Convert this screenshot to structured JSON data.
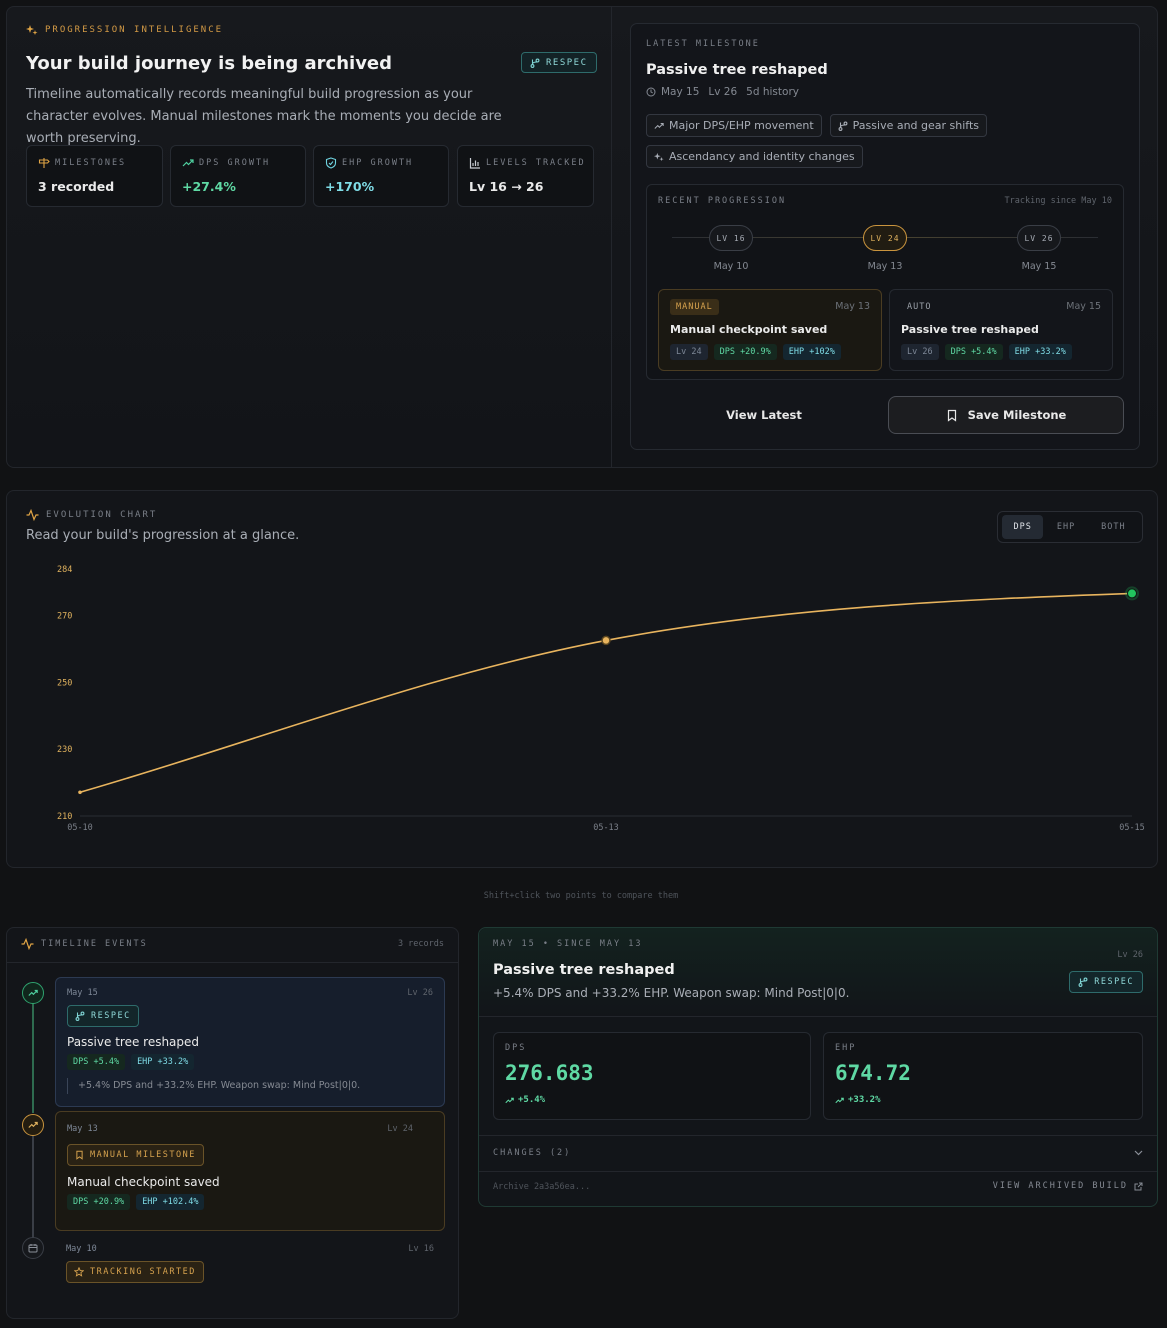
{
  "hero": {
    "eyebrow": "PROGRESSION INTELLIGENCE",
    "title": "Your build journey is being archived",
    "badge": "RESPEC",
    "description": "Timeline automatically records meaningful build progression as your character evolves. Manual milestones mark the moments you decide are worth preserving.",
    "stats": [
      {
        "label": "MILESTONES",
        "value": "3 recorded",
        "icon": "signpost-icon"
      },
      {
        "label": "DPS GROWTH",
        "value": "+27.4%",
        "icon": "trend-up-icon"
      },
      {
        "label": "EHP GROWTH",
        "value": "+170%",
        "icon": "shield-icon"
      },
      {
        "label": "LEVELS TRACKED",
        "value": "Lv 16 → 26",
        "icon": "bar-chart-icon"
      }
    ]
  },
  "latest": {
    "eyebrow": "LATEST MILESTONE",
    "title": "Passive tree reshaped",
    "date": "May 15",
    "level": "Lv 26",
    "history": "5d history",
    "tags": [
      "Major DPS/EHP movement",
      "Passive and gear shifts",
      "Ascendancy and identity changes"
    ],
    "recent": {
      "label": "RECENT PROGRESSION",
      "since": "Tracking since May 10",
      "nodes": [
        {
          "level": "LV 16",
          "date": "May 10"
        },
        {
          "level": "LV 24",
          "date": "May 13"
        },
        {
          "level": "LV 26",
          "date": "May 15"
        }
      ],
      "cards": [
        {
          "type": "MANUAL",
          "date": "May 13",
          "title": "Manual checkpoint saved",
          "lv": "Lv 24",
          "dps": "DPS +20.9%",
          "ehp": "EHP +102%"
        },
        {
          "type": "AUTO",
          "date": "May 15",
          "title": "Passive tree reshaped",
          "lv": "Lv 26",
          "dps": "DPS +5.4%",
          "ehp": "EHP +33.2%"
        }
      ]
    },
    "view_latest": "View Latest",
    "save_milestone": "Save Milestone"
  },
  "chart": {
    "eyebrow": "EVOLUTION CHART",
    "subtitle": "Read your build's progression at a glance.",
    "toggles": [
      "DPS",
      "EHP",
      "BOTH"
    ],
    "hint": "Shift+click two points to compare them"
  },
  "chart_data": {
    "type": "line",
    "x": [
      "05-10",
      "05-13",
      "05-15"
    ],
    "series": [
      {
        "values": [
          217.1,
          262.6,
          276.683
        ]
      }
    ],
    "ylim": [
      210,
      284
    ],
    "yticks": [
      210,
      230,
      250,
      270,
      284
    ],
    "grid": false,
    "colors": {
      "line": "#e8b45e",
      "end_point": "#22c55e"
    }
  },
  "timeline": {
    "title": "TIMELINE EVENTS",
    "count": "3 records",
    "events": [
      {
        "date": "May 15",
        "level": "Lv 26",
        "badge": "RESPEC",
        "title": "Passive tree reshaped",
        "dps": "DPS +5.4%",
        "ehp": "EHP +33.2%",
        "note": "+5.4% DPS and +33.2% EHP. Weapon swap: Mind Post|0|0."
      },
      {
        "date": "May 13",
        "level": "Lv 24",
        "badge": "MANUAL MILESTONE",
        "title": "Manual checkpoint saved",
        "dps": "DPS +20.9%",
        "ehp": "EHP +102.4%"
      },
      {
        "date": "May 10",
        "level": "Lv 16",
        "badge": "TRACKING STARTED"
      }
    ]
  },
  "detail": {
    "header": "MAY 15 • SINCE MAY 13",
    "level": "Lv 26",
    "title": "Passive tree reshaped",
    "badge": "RESPEC",
    "description": "+5.4% DPS and +33.2% EHP. Weapon swap: Mind Post|0|0.",
    "dps": {
      "label": "DPS",
      "value": "276.683",
      "change": "+5.4%"
    },
    "ehp": {
      "label": "EHP",
      "value": "674.72",
      "change": "+33.2%"
    },
    "changes": "CHANGES (2)",
    "archive": "Archive 2a3a56ea...",
    "view_archived": "VIEW ARCHIVED BUILD"
  }
}
